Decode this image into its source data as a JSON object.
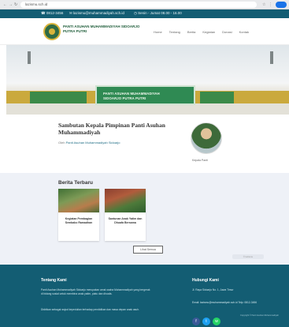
{
  "browser": {
    "url": "lazismu.sch.id",
    "back_icon": "arrow-left-icon",
    "forward_icon": "arrow-right-icon",
    "reload_icon": "reload-icon",
    "ext_icon_1": "☆",
    "ext_icon_2": "⋮"
  },
  "topbar": {
    "phone": "☎ 0812-3456",
    "email": "✉ lazismu@muhammadiyah.sch.id",
    "hours": "◷ Senin - Jumat 08.00 - 16.00"
  },
  "header": {
    "brand": "PANTI ASUHAN MUHAMMADIYAH SIDOARJO PUTRA PUTRI",
    "menu": [
      "Home",
      "Tentang",
      "Berita",
      "Kegiatan",
      "Donasi",
      "Kontak"
    ]
  },
  "hero": {
    "banner_line1": "PANTI ASUHAN MUHAMMADIYAH",
    "banner_line2": "SIDOARJO PUTRA PUTRI"
  },
  "profile": {
    "title": "Sambutan Kepala Pimpinan Panti Asuhan Muhammadiyah",
    "meta_prefix": "Oleh",
    "meta_link": "Panti Asuhan Muhammadiyah Sidoarjo",
    "avatar_name": "Kepala Panti"
  },
  "posts": {
    "section_title": "Berita Terbaru",
    "cards": [
      {
        "caption": "Kegiatan Pembagian Sembako Ramadhan"
      },
      {
        "caption": "Santunan Anak Yatim dan Dhuafa Bersama"
      }
    ],
    "more_button": "Lihat Semua",
    "badge": "© lazismu"
  },
  "footer": {
    "col1_title": "Tentang Kami",
    "about": "Panti Asuhan Muhammadiyah Sidoarjo merupakan amal usaha Muhammadiyah yang bergerak di bidang sosial untuk membina anak yatim, piatu dan dhuafa.",
    "about2": "Didirikan sebagai wujud kepedulian terhadap pendidikan dan masa depan anak asuh.",
    "col2_title": "Hubungi Kami",
    "address": "Jl. Raya Sidoarjo No. 1, Jawa Timur",
    "contact": "Email: lazismu@muhammadiyah.sch.id Telp: 0812-3456",
    "social": [
      {
        "icon": "facebook-icon",
        "glyph": "f"
      },
      {
        "icon": "twitter-icon",
        "glyph": "t"
      },
      {
        "icon": "whatsapp-icon",
        "glyph": "w"
      }
    ],
    "copyright": "Copyright © Panti Asuhan Muhammadiyah"
  },
  "colors": {
    "primary": "#135d73",
    "banner_green": "#2f8a53",
    "section_bg": "#eef1f7"
  }
}
